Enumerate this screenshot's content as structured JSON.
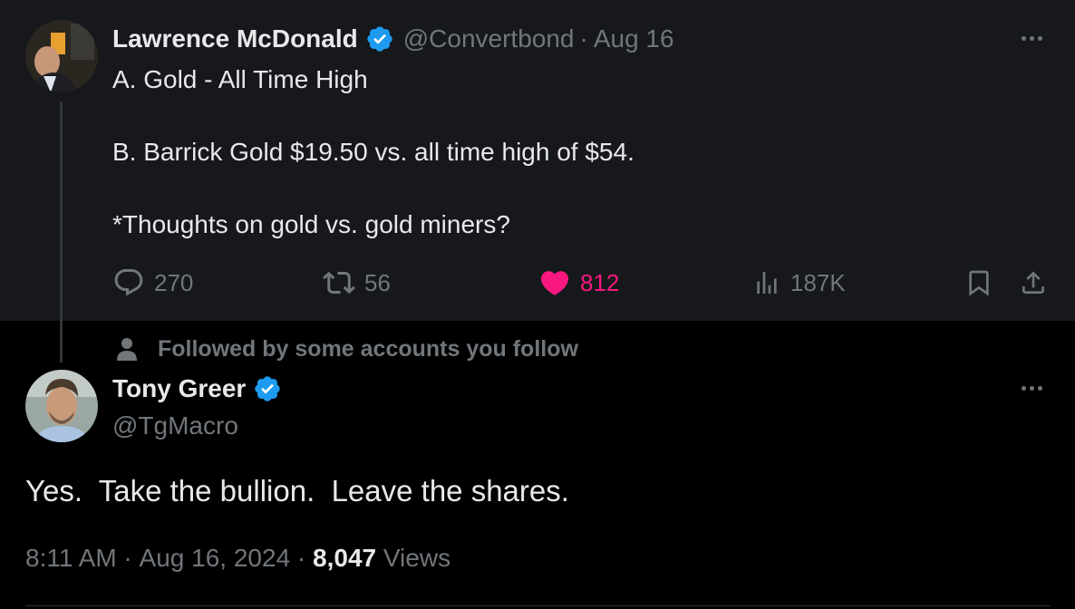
{
  "parent_tweet": {
    "author_name": "Lawrence McDonald",
    "handle": "@Convertbond",
    "separator": "·",
    "date": "Aug 16",
    "text_lines": [
      "A. Gold - All Time High",
      "B. Barrick Gold $19.50 vs. all time high of $54.",
      "*Thoughts on gold vs. gold miners?"
    ],
    "stats": {
      "replies": "270",
      "reposts": "56",
      "likes": "812",
      "views": "187K"
    },
    "liked": true,
    "avatar_icon": "avatar-photo-icon"
  },
  "social_context": {
    "label": "Followed by some accounts you follow",
    "icon": "person-icon"
  },
  "reply_tweet": {
    "author_name": "Tony Greer",
    "handle": "@TgMacro",
    "text": "Yes.  Take the bullion.  Leave the shares.",
    "time": "8:11 AM",
    "sep1": " · ",
    "date": "Aug 16, 2024",
    "sep2": " · ",
    "views_count": "8,047",
    "views_label": " Views",
    "avatar_icon": "avatar-photo-icon"
  },
  "colors": {
    "background": "#000000",
    "parent_background": "#16181c",
    "text": "#e7e9ea",
    "secondary": "#71767b",
    "verified": "#1d9bf0",
    "like": "#f91880"
  }
}
